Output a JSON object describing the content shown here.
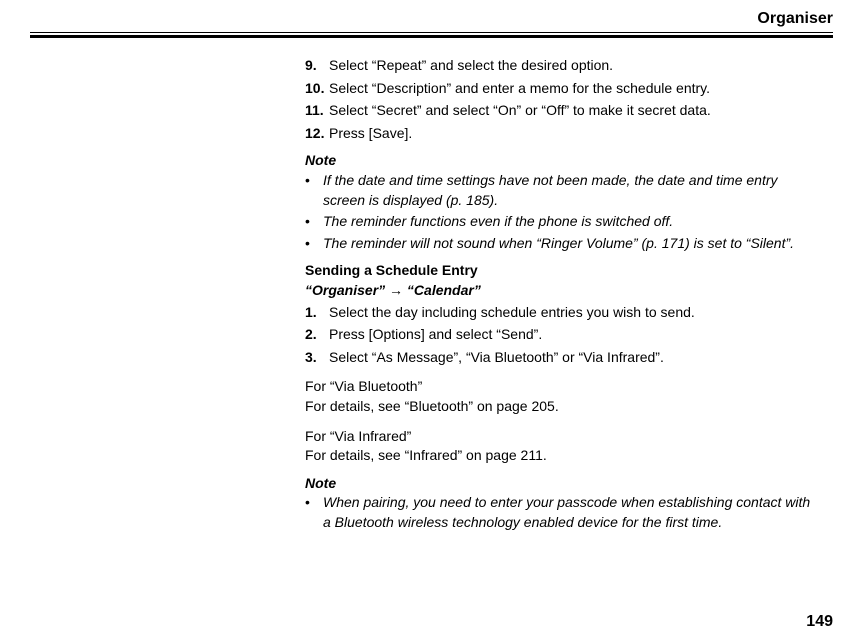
{
  "header": {
    "title": "Organiser"
  },
  "steps_top": [
    {
      "num": "9.",
      "text": "Select “Repeat” and select the desired option."
    },
    {
      "num": "10.",
      "text": "Select “Description” and enter a memo for the schedule entry."
    },
    {
      "num": "11.",
      "text": "Select “Secret” and select “On” or “Off” to make it secret data."
    },
    {
      "num": "12.",
      "text": "Press [Save]."
    }
  ],
  "note1": {
    "title": "Note",
    "items": [
      "If the date and time settings have not been made, the date and time entry screen is displayed (p. 185).",
      "The reminder functions even if the phone is switched off.",
      "The reminder will not sound when “Ringer Volume” (p. 171) is set to “Silent”."
    ]
  },
  "section2": {
    "heading": "Sending a Schedule Entry",
    "breadcrumb": "“Organiser” → “Calendar”",
    "steps": [
      {
        "num": "1.",
        "text": "Select the day including schedule entries you wish to send."
      },
      {
        "num": "2.",
        "text": "Press [Options] and select “Send”."
      },
      {
        "num": "3.",
        "text": "Select “As Message”, “Via Bluetooth” or “Via Infrared”."
      }
    ]
  },
  "bluetooth": {
    "heading": "For “Via Bluetooth”",
    "text": "For details, see “Bluetooth” on page 205."
  },
  "infrared": {
    "heading": "For “Via Infrared”",
    "text": "For details, see “Infrared” on page 211."
  },
  "note2": {
    "title": "Note",
    "items": [
      "When pairing, you need to enter your passcode when establishing contact with a Bluetooth wireless technology enabled device for the first time."
    ]
  },
  "page_number": "149"
}
